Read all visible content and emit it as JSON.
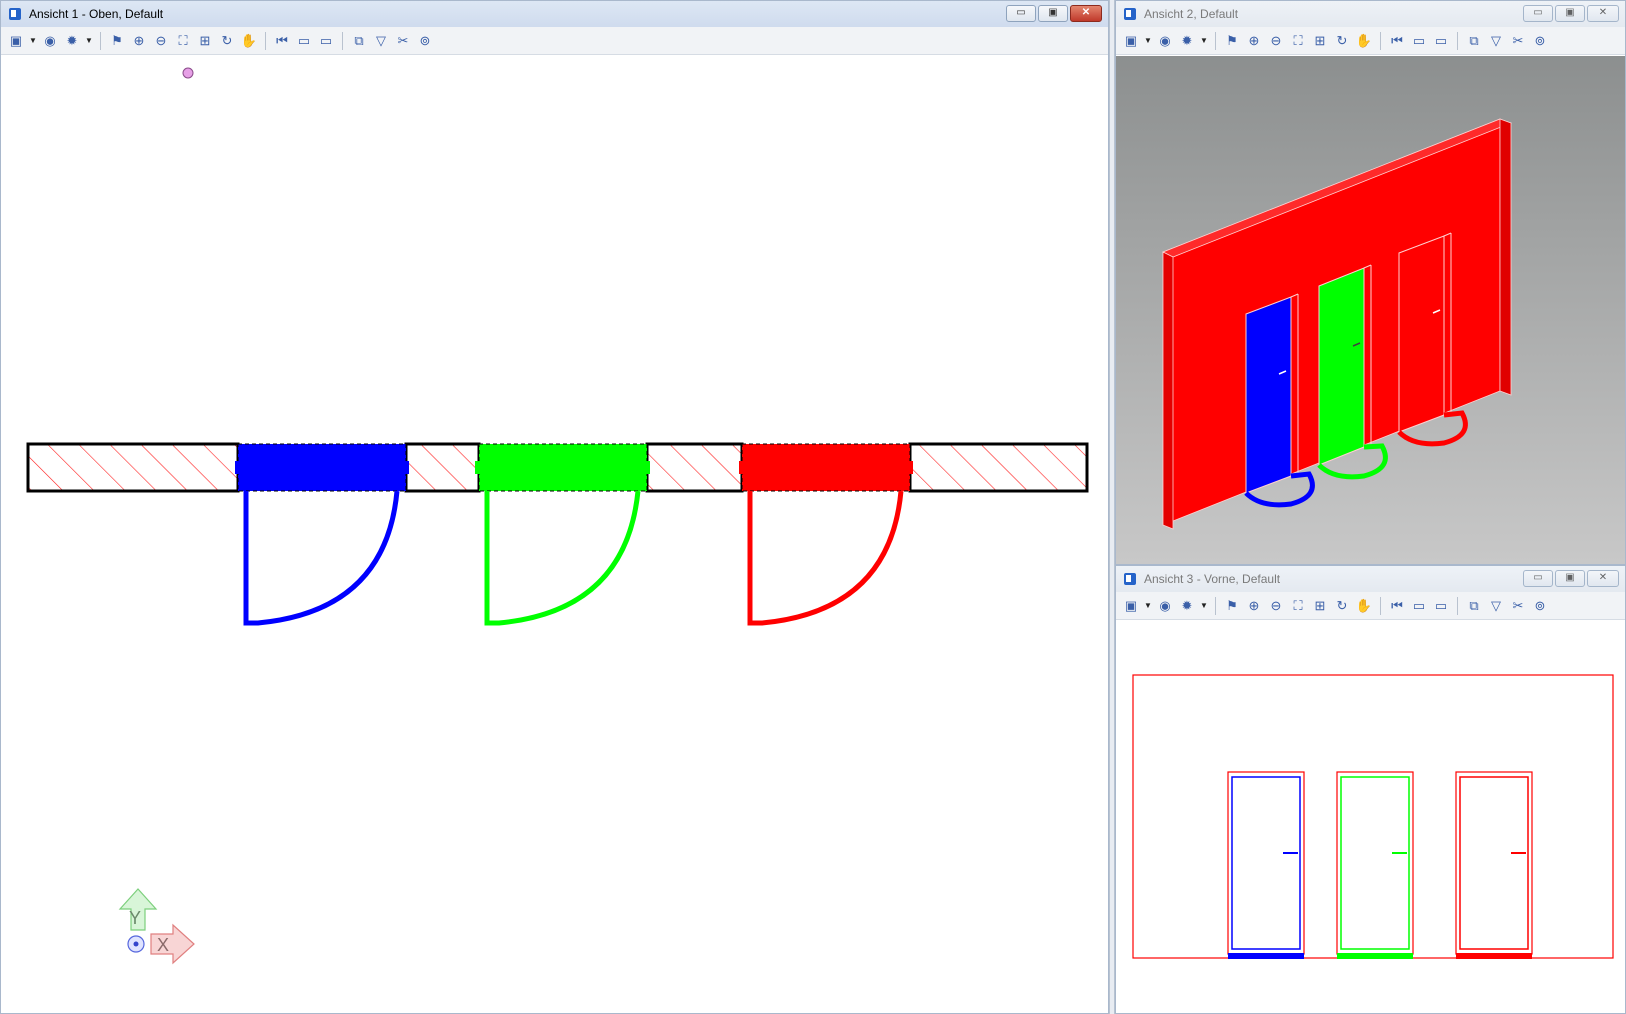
{
  "view1": {
    "title": "Ansicht 1 - Oben, Default",
    "buttons": {
      "minimize": "▭",
      "restore": "▣",
      "close": "✕"
    },
    "axis": {
      "y_label": "Y",
      "x_label": "X"
    }
  },
  "view2": {
    "title": "Ansicht 2, Default",
    "buttons": {
      "minimize": "▭",
      "restore": "▣",
      "close": "✕"
    }
  },
  "view3": {
    "title": "Ansicht 3 - Vorne, Default",
    "buttons": {
      "minimize": "▭",
      "restore": "▣",
      "close": "✕"
    }
  },
  "toolbar_icons": [
    "view-attributes-icon",
    "display-style-icon",
    "lighting-icon",
    "update-view-icon",
    "zoom-in-icon",
    "zoom-out-icon",
    "fit-view-icon",
    "window-area-icon",
    "rotate-view-icon",
    "pan-icon",
    "previous-view-icon",
    "next-view-icon",
    "copy-view-icon",
    "clip-volume-icon",
    "view-filter-icon",
    "clip-mask-icon",
    "camera-icon"
  ],
  "colors": {
    "wall_hatch": "#ff2020",
    "door_blue": "#0000ff",
    "door_green": "#00ff00",
    "door_red": "#ff0000",
    "view2_bg_top": "#8c8f8f",
    "view2_bg_bottom": "#c8c8c8"
  },
  "doors": [
    "blue",
    "green",
    "red"
  ]
}
